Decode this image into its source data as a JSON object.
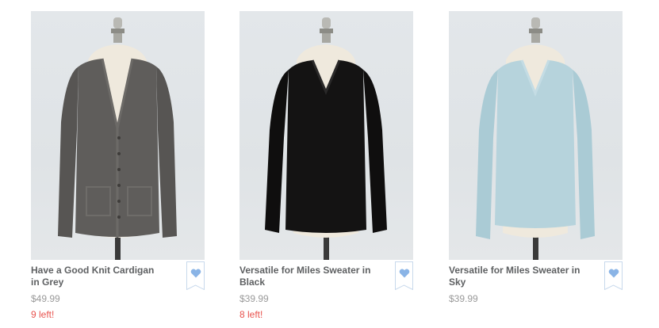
{
  "products": [
    {
      "name": "Have a Good Knit Cardigan in Grey",
      "price": "$49.99",
      "stock": "9 left!",
      "image_icon": "grey-cardigan-on-mannequin",
      "garment_color": "#5f5d5b"
    },
    {
      "name": "Versatile for Miles Sweater in Black",
      "price": "$39.99",
      "stock": "8 left!",
      "image_icon": "black-sweater-on-mannequin",
      "garment_color": "#141313"
    },
    {
      "name": "Versatile for Miles Sweater in Sky",
      "price": "$39.99",
      "stock": "",
      "image_icon": "sky-sweater-on-mannequin",
      "garment_color": "#b6d3dc"
    }
  ],
  "colors": {
    "name_text": "#5e6062",
    "price_text": "#9a9a9a",
    "stock_text": "#e8534e",
    "wishlist_heart": "#8ab4e6",
    "wishlist_border": "#c8d9ec"
  }
}
